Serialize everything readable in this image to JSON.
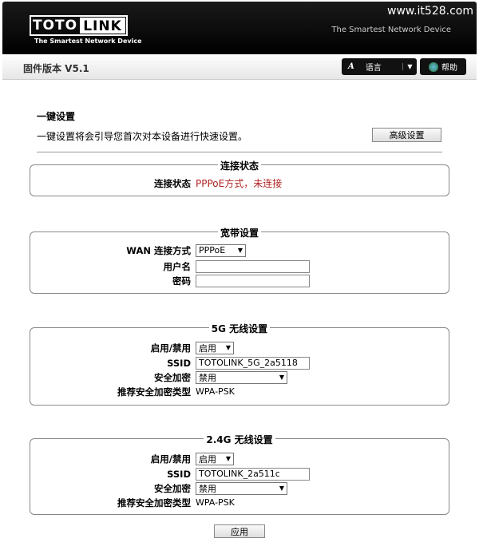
{
  "header": {
    "logo_left": "TOTO",
    "logo_right": "LINK",
    "logo_tagline": "The Smartest Network Device",
    "watermark": "www.it528.com",
    "tagline": "The Smartest Network Device"
  },
  "toolbar": {
    "firmware": "固件版本 V5.1",
    "language": "语言",
    "help": "帮助"
  },
  "intro": {
    "title": "一键设置",
    "description": "一键设置将会引导您首次对本设备进行快速设置。",
    "advanced_button": "高级设置"
  },
  "status": {
    "legend": "连接状态",
    "label": "连接状态",
    "value": "PPPoE方式，未连接",
    "value_color": "#b22222"
  },
  "broadband": {
    "legend": "宽带设置",
    "wan_label": "WAN 连接方式",
    "wan_value": "PPPoE",
    "user_label": "用户名",
    "user_value": "",
    "pass_label": "密码",
    "pass_value": ""
  },
  "wifi5g": {
    "legend": "5G 无线设置",
    "enable_label": "启用/禁用",
    "enable_value": "启用",
    "ssid_label": "SSID",
    "ssid_value": "TOTOLINK_5G_2a5118",
    "security_label": "安全加密",
    "security_value": "禁用",
    "rec_label": "推荐安全加密类型",
    "rec_value": "WPA-PSK"
  },
  "wifi24": {
    "legend": "2.4G 无线设置",
    "enable_label": "启用/禁用",
    "enable_value": "启用",
    "ssid_label": "SSID",
    "ssid_value": "TOTOLINK_2a511c",
    "security_label": "安全加密",
    "security_value": "禁用",
    "rec_label": "推荐安全加密类型",
    "rec_value": "WPA-PSK"
  },
  "apply_button": "应用"
}
